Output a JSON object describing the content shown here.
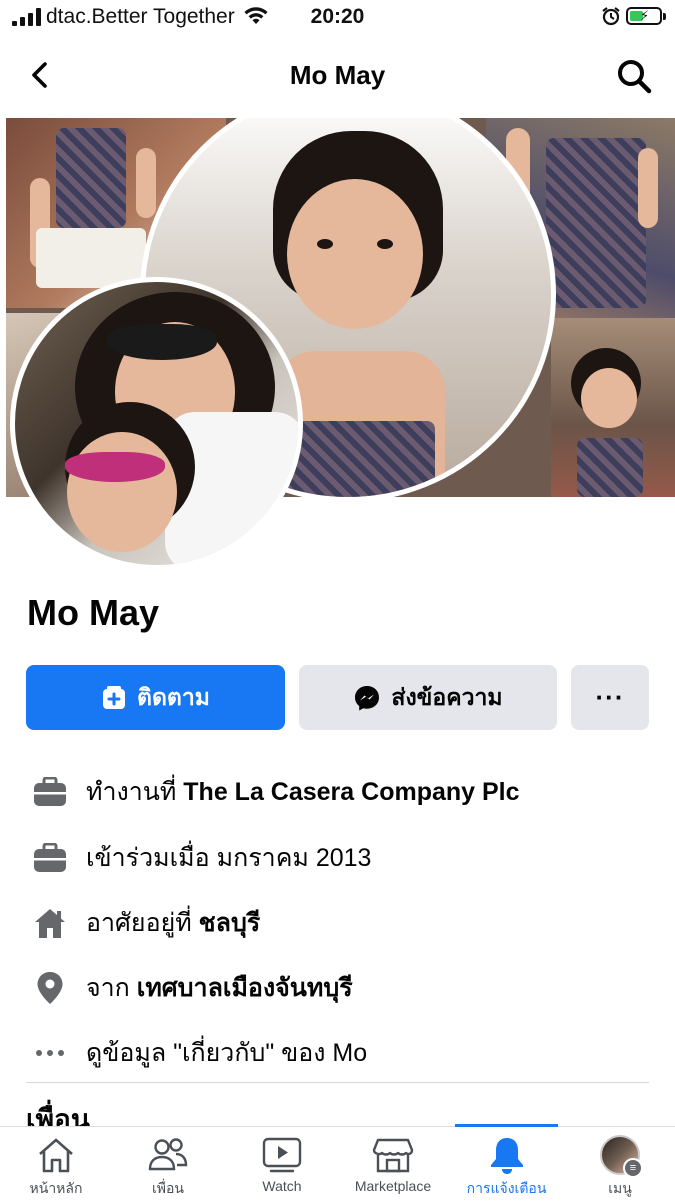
{
  "status_bar": {
    "carrier": "dtac.Better Together",
    "time": "20:20",
    "battery_level": 0.45
  },
  "header": {
    "title": "Mo May"
  },
  "profile": {
    "name": "Mo May"
  },
  "actions": {
    "follow_label": "ติดตาม",
    "message_label": "ส่งข้อความ",
    "more_label": "···"
  },
  "info": {
    "work_prefix": "ทำงานที่ ",
    "work_value": "The La Casera Company Plc",
    "joined_prefix": "เข้าร่วมเมื่อ ",
    "joined_value": "มกราคม 2013",
    "lives_prefix": "อาศัยอยู่ที่ ",
    "lives_value": "ชลบุรี",
    "from_prefix": "จาก ",
    "from_value": "เทศบาลเมืองจันทบุรี",
    "about_link": "ดูข้อมูล \"เกี่ยวกับ\" ของ Mo"
  },
  "friends_heading": "เพื่อน",
  "tab_bar": {
    "items": [
      {
        "label": "หน้าหลัก",
        "icon": "home-icon"
      },
      {
        "label": "เพื่อน",
        "icon": "friends-icon"
      },
      {
        "label": "Watch",
        "icon": "watch-icon"
      },
      {
        "label": "Marketplace",
        "icon": "marketplace-icon"
      },
      {
        "label": "การแจ้งเตือน",
        "icon": "bell-icon",
        "active": true
      },
      {
        "label": "เมนู",
        "icon": "menu-avatar"
      }
    ]
  },
  "colors": {
    "accent": "#1877f2",
    "secondary_button": "#e4e6eb",
    "icon_gray": "#65676b"
  }
}
